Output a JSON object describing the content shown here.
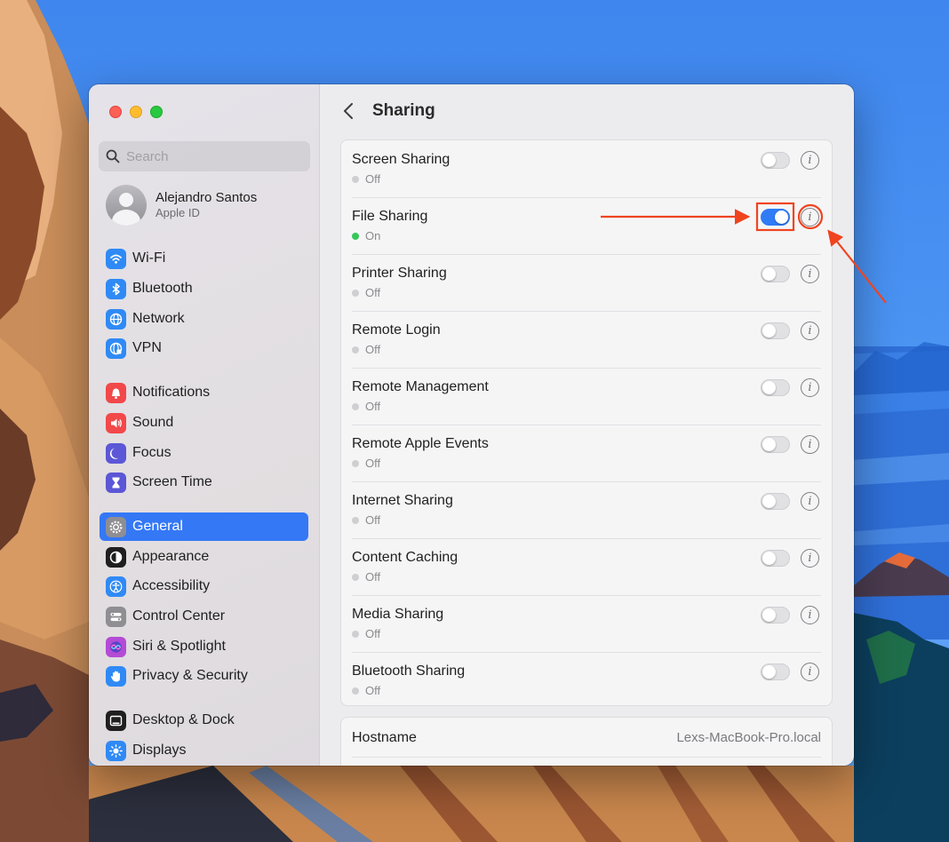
{
  "window": {
    "traffic_lights": [
      "close",
      "minimize",
      "zoom"
    ]
  },
  "sidebar": {
    "search": {
      "placeholder": "Search",
      "value": ""
    },
    "account": {
      "name": "Alejandro Santos",
      "subtitle": "Apple ID"
    },
    "items": [
      {
        "label": "Wi-Fi",
        "icon": "wifi-icon",
        "color": "#2f8af5"
      },
      {
        "label": "Bluetooth",
        "icon": "bluetooth-icon",
        "color": "#2f8af5"
      },
      {
        "label": "Network",
        "icon": "globe-icon",
        "color": "#2f8af5"
      },
      {
        "label": "VPN",
        "icon": "vpn-globe-icon",
        "color": "#2f8af5"
      },
      {
        "label": "Notifications",
        "icon": "bell-icon",
        "color": "#f2484a"
      },
      {
        "label": "Sound",
        "icon": "speaker-icon",
        "color": "#f2484a"
      },
      {
        "label": "Focus",
        "icon": "moon-icon",
        "color": "#5b57d6"
      },
      {
        "label": "Screen Time",
        "icon": "hourglass-icon",
        "color": "#5b57d6"
      },
      {
        "label": "General",
        "icon": "gear-icon",
        "color": "#8e8e93",
        "active": true
      },
      {
        "label": "Appearance",
        "icon": "appearance-icon",
        "color": "#1f1f1f"
      },
      {
        "label": "Accessibility",
        "icon": "accessibility-icon",
        "color": "#2f8af5"
      },
      {
        "label": "Control Center",
        "icon": "control-center-icon",
        "color": "#8e8e93"
      },
      {
        "label": "Siri & Spotlight",
        "icon": "siri-icon",
        "color": "#b44bd6"
      },
      {
        "label": "Privacy & Security",
        "icon": "hand-icon",
        "color": "#2f8af5"
      },
      {
        "label": "Desktop & Dock",
        "icon": "dock-icon",
        "color": "#1f1f1f"
      },
      {
        "label": "Displays",
        "icon": "sun-icon",
        "color": "#2f8af5"
      }
    ]
  },
  "main": {
    "title": "Sharing",
    "services": [
      {
        "title": "Screen Sharing",
        "status": "Off",
        "on": false
      },
      {
        "title": "File Sharing",
        "status": "On",
        "on": true
      },
      {
        "title": "Printer Sharing",
        "status": "Off",
        "on": false
      },
      {
        "title": "Remote Login",
        "status": "Off",
        "on": false
      },
      {
        "title": "Remote Management",
        "status": "Off",
        "on": false
      },
      {
        "title": "Remote Apple Events",
        "status": "Off",
        "on": false
      },
      {
        "title": "Internet Sharing",
        "status": "Off",
        "on": false
      },
      {
        "title": "Content Caching",
        "status": "Off",
        "on": false
      },
      {
        "title": "Media Sharing",
        "status": "Off",
        "on": false
      },
      {
        "title": "Bluetooth Sharing",
        "status": "Off",
        "on": false
      }
    ],
    "hostname": {
      "label": "Hostname",
      "value": "Lexs-MacBook-Pro.local"
    }
  },
  "colors": {
    "accent": "#3478f6",
    "toggle_on": "#2f7cf6",
    "status_on": "#34c759",
    "annotation": "#f0441f"
  }
}
